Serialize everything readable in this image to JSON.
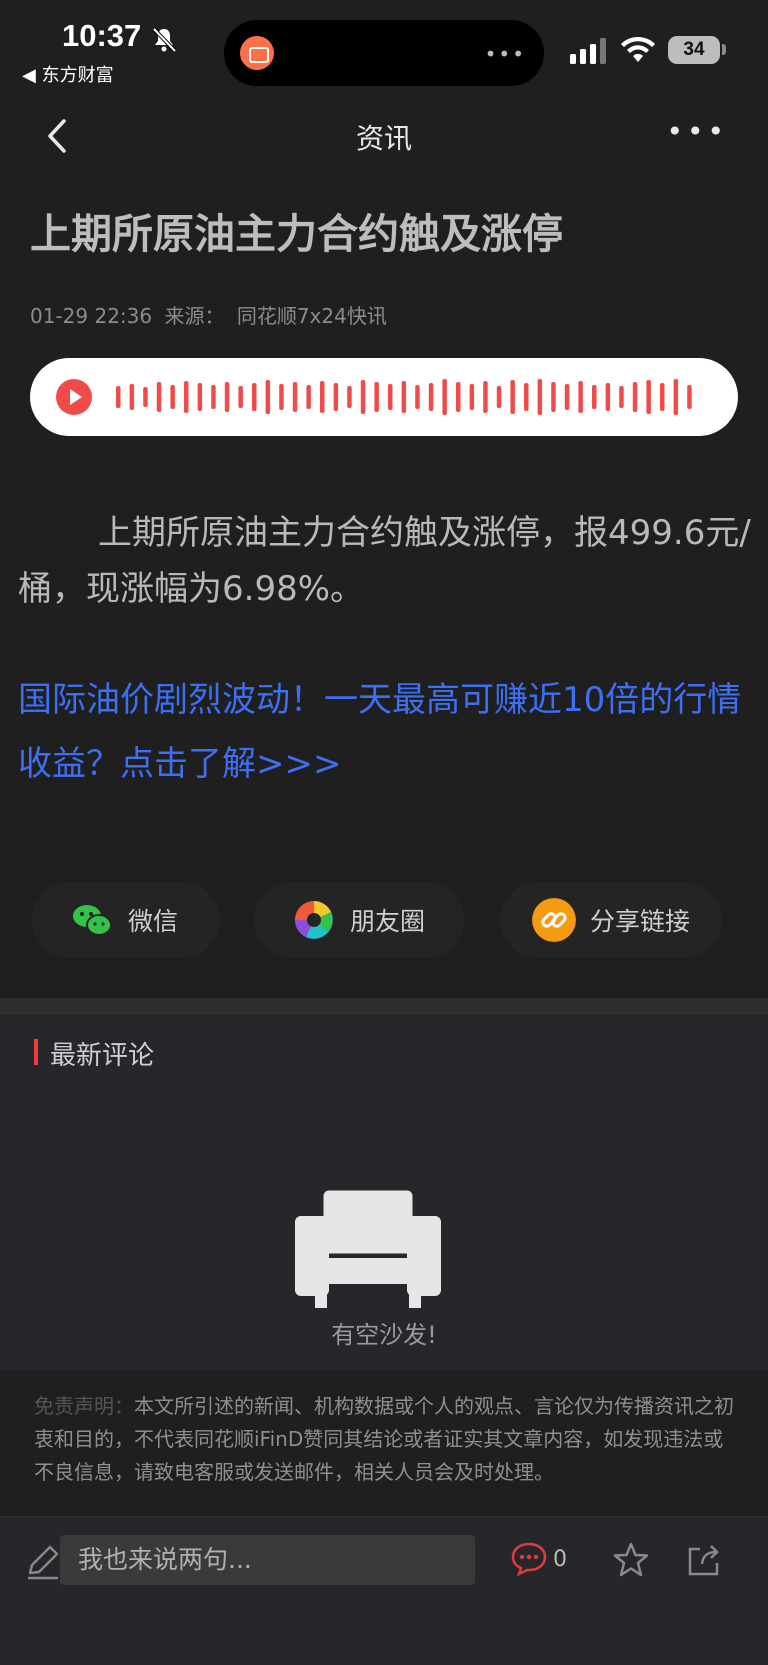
{
  "status_bar": {
    "time": "10:37",
    "back_app": "◀ 东方财富",
    "island_dots": "•••",
    "battery": "34"
  },
  "nav": {
    "title": "资讯",
    "more": "•••"
  },
  "article": {
    "headline": "上期所原油主力合约触及涨停",
    "date": "01-29 22:36",
    "source_label": "来源：",
    "source": "同花顺7x24快讯",
    "body": "上期所原油主力合约触及涨停，报499.6元/桶，现涨幅为6.98%。",
    "promo": "国际油价剧烈波动！一天最高可赚近10倍的行情收益？点击了解>>>"
  },
  "share": {
    "wechat": "微信",
    "moments": "朋友圈",
    "link": "分享链接"
  },
  "comments": {
    "title": "最新评论",
    "empty": "有空沙发!"
  },
  "disclaimer": {
    "label": "免责声明：",
    "text": "本文所引述的新闻、机构数据或个人的观点、言论仅为传播资讯之初衷和目的，不代表同花顺iFinD赞同其结论或者证实其文章内容，如发现违法或不良信息，请致电客服或发送邮件，相关人员会及时处理。"
  },
  "bottom_bar": {
    "input_placeholder": "我也来说两句...",
    "comment_count": "0"
  },
  "colors": {
    "accent_red": "#f04b4b",
    "link_blue": "#3d6ff5",
    "background": "#1f1f1f"
  },
  "icons": [
    "bell-muted-icon",
    "signal-icon",
    "wifi-icon",
    "battery-icon",
    "back-icon",
    "more-icon",
    "play-icon",
    "wechat-icon",
    "moments-icon",
    "link-icon",
    "sofa-icon",
    "pen-icon",
    "comment-icon",
    "star-icon",
    "share-icon"
  ]
}
